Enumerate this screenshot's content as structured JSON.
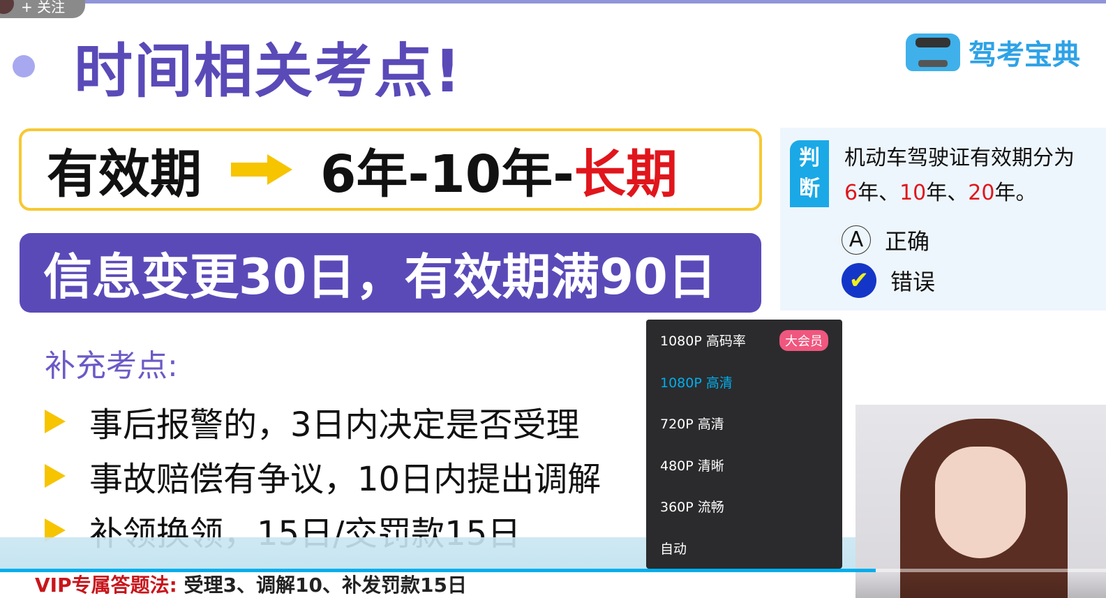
{
  "uploader": {
    "follow_label": "+ 关注"
  },
  "slide": {
    "title": "时间相关考点!",
    "logo_text": "驾考宝典",
    "validity": {
      "label": "有效期",
      "value": "6年-10年-",
      "highlight": "长期"
    },
    "banner": "信息变更30日，有效期满90日",
    "supplement_title": "补充考点:",
    "items": [
      "事后报警的，3日内决定是否受理",
      "事故赔偿有争议，10日内提出调解",
      "补领换领，15日/交罚款15日"
    ],
    "vip": {
      "label": "VIP专属答题法:",
      "text": "受理3、调解10、补发罚款15日"
    },
    "quiz": {
      "tag": "判断",
      "question_line1": "机动车驾驶证有效期分为",
      "q_6": "6",
      "q_y1": "年、",
      "q_10": "10",
      "q_y2": "年、",
      "q_20": "20",
      "q_end": "年。",
      "options": [
        {
          "letter": "A",
          "label": "正确"
        },
        {
          "letter": "✔",
          "label": "错误"
        }
      ]
    }
  },
  "quality_menu": {
    "items": [
      {
        "label": "1080P 高码率",
        "badge": "大会员"
      },
      {
        "label": "1080P 高清",
        "active": true
      },
      {
        "label": "720P 高清"
      },
      {
        "label": "480P 清晰"
      },
      {
        "label": "360P 流畅"
      },
      {
        "label": "自动"
      }
    ]
  },
  "player": {
    "progress_percent": 79.2,
    "accent": "#00aeec"
  }
}
